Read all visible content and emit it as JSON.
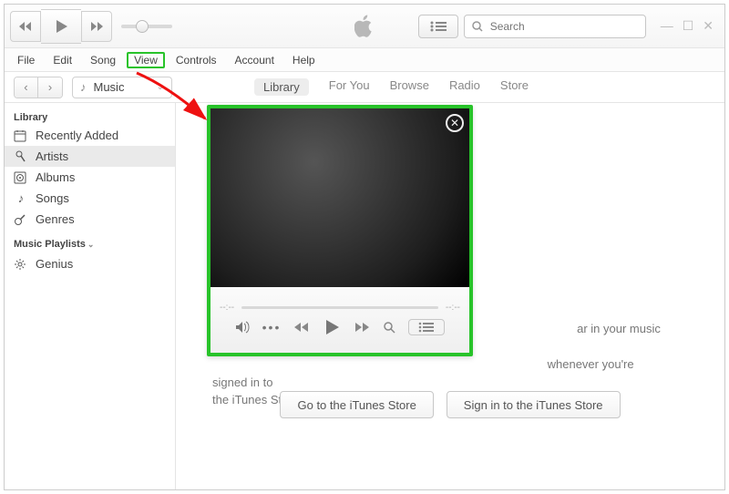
{
  "search": {
    "placeholder": "Search"
  },
  "menu": {
    "file": "File",
    "edit": "Edit",
    "song": "Song",
    "view": "View",
    "controls": "Controls",
    "account": "Account",
    "help": "Help"
  },
  "libselect": {
    "label": "Music"
  },
  "tabs": {
    "library": "Library",
    "for_you": "For You",
    "browse": "Browse",
    "radio": "Radio",
    "store": "Store"
  },
  "sidebar": {
    "head_library": "Library",
    "items": [
      {
        "label": "Recently Added"
      },
      {
        "label": "Artists"
      },
      {
        "label": "Albums"
      },
      {
        "label": "Songs"
      },
      {
        "label": "Genres"
      }
    ],
    "head_playlists": "Music Playlists",
    "genius": "Genius"
  },
  "miniplayer": {
    "time_left": "--:--",
    "time_right": "--:--"
  },
  "main": {
    "desc_tail_1": "ar in your music library. Your",
    "desc_tail_2": "whenever you're signed in to",
    "desc_tail_3": "the iTunes Store.",
    "btn_store": "Go to the iTunes Store",
    "btn_signin": "Sign in to the iTunes Store"
  }
}
